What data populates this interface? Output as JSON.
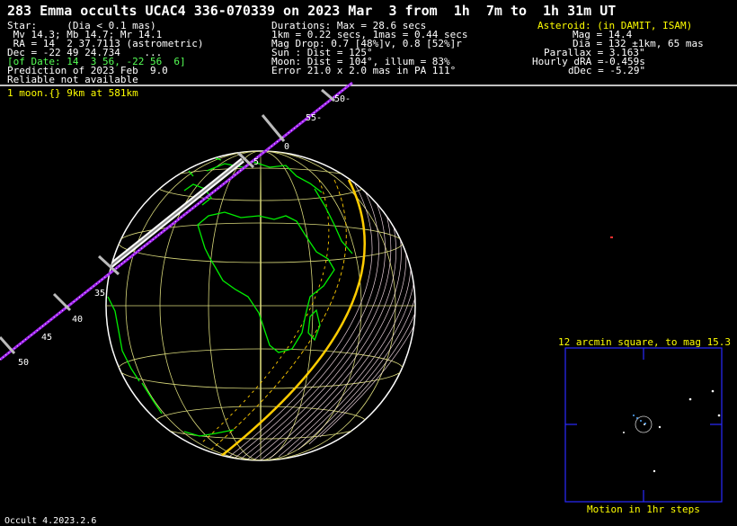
{
  "header": {
    "title": "283 Emma occults UCAC4 336-070339 on 2023 Mar  3 from  1h  7m to  1h 31m UT"
  },
  "star": {
    "l1": "Star:     (Dia < 0.1 mas)",
    "l2": " Mv 14.3; Mb 14.7; Mr 14.1",
    "l3": " RA = 14  2 37.7113 (astrometric)",
    "l4": "Dec = -22 49 24.734    ...",
    "l5": "[of Date: 14  3 56, -22 56  6]",
    "l6": "Prediction of 2023 Feb  9.0",
    "l7": "Reliable not available"
  },
  "event": {
    "l1": "Durations: Max = 28.6 secs",
    "l2": "1km = 0.22 secs, 1mas = 0.44 secs",
    "l3": "Mag Drop: 0.7 [48%]v, 0.8 [52%]r",
    "l4": "Sun : Dist = 125°",
    "l5": "Moon: Dist = 104°, illum = 83%",
    "l6": "Error 21.0 x 2.0 mas in PA 111°"
  },
  "asteroid": {
    "l1": "Asteroid: (in DAMIT, ISAM)",
    "l2": "Mag = 14.4",
    "l3": "Dia = 132 ±1km, 65 mas",
    "l4": "Parallax = 3.163\"",
    "l5": "Hourly dRA =-0.459s",
    "l6": "dDec = -5.29\""
  },
  "moon_note": "1 moon.{} 9km at 581km",
  "path_labels": [
    "50-",
    "55-",
    "0",
    "5",
    "35",
    "40",
    "45",
    "50"
  ],
  "starchart": {
    "title": "12 arcmin square, to mag 15.3",
    "caption": "Motion in 1hr steps"
  },
  "footer": "Occult 4.2023.2.6",
  "colors": {
    "background": "#000000",
    "text": "#ffffff",
    "highlight": "#ffff00",
    "coastline": "#00ee00",
    "grid": "#d8d87a",
    "shadow_path": "#a020f0",
    "terminator": "#ffcc00",
    "chart_frame": "#2a2aff"
  }
}
